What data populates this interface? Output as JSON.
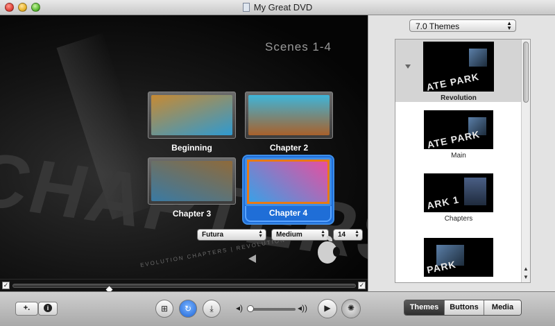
{
  "window": {
    "title": "My Great DVD"
  },
  "preview": {
    "scene_title": "Scenes 1-4",
    "background_text": "CHAPTERS",
    "background_tagline": "EVOLUTION CHAPTERS | REVOLUTION",
    "chapters": [
      {
        "label": "Beginning",
        "colors": [
          "#c78a33",
          "#2f9ad0"
        ]
      },
      {
        "label": "Chapter 2",
        "colors": [
          "#3fb5d8",
          "#a8612b"
        ]
      },
      {
        "label": "Chapter 3",
        "colors": [
          "#8f6a3a",
          "#3a7aa3"
        ]
      },
      {
        "label": "Chapter 4",
        "colors": [
          "#e64fa0",
          "#3aa0e6"
        ],
        "selected": true
      }
    ],
    "font_controls": {
      "family": "Futura",
      "weight": "Medium",
      "size": "14"
    }
  },
  "theme_panel": {
    "selector_value": "7.0 Themes",
    "themes": [
      {
        "name": "Revolution",
        "thumb_text": "ATE PARK",
        "selected": true
      },
      {
        "name": "Main",
        "thumb_text": "ATE PARK"
      },
      {
        "name": "Chapters",
        "thumb_text": "ARK 1"
      },
      {
        "name": "",
        "thumb_text": "PARK"
      }
    ]
  },
  "toolbar": {
    "add_label": "+.",
    "info_label": "i",
    "tabs": [
      {
        "label": "Themes",
        "active": true
      },
      {
        "label": "Buttons"
      },
      {
        "label": "Media"
      }
    ]
  },
  "colors": {
    "accent": "#1f6ed7",
    "selection_orange": "#e87a14"
  }
}
